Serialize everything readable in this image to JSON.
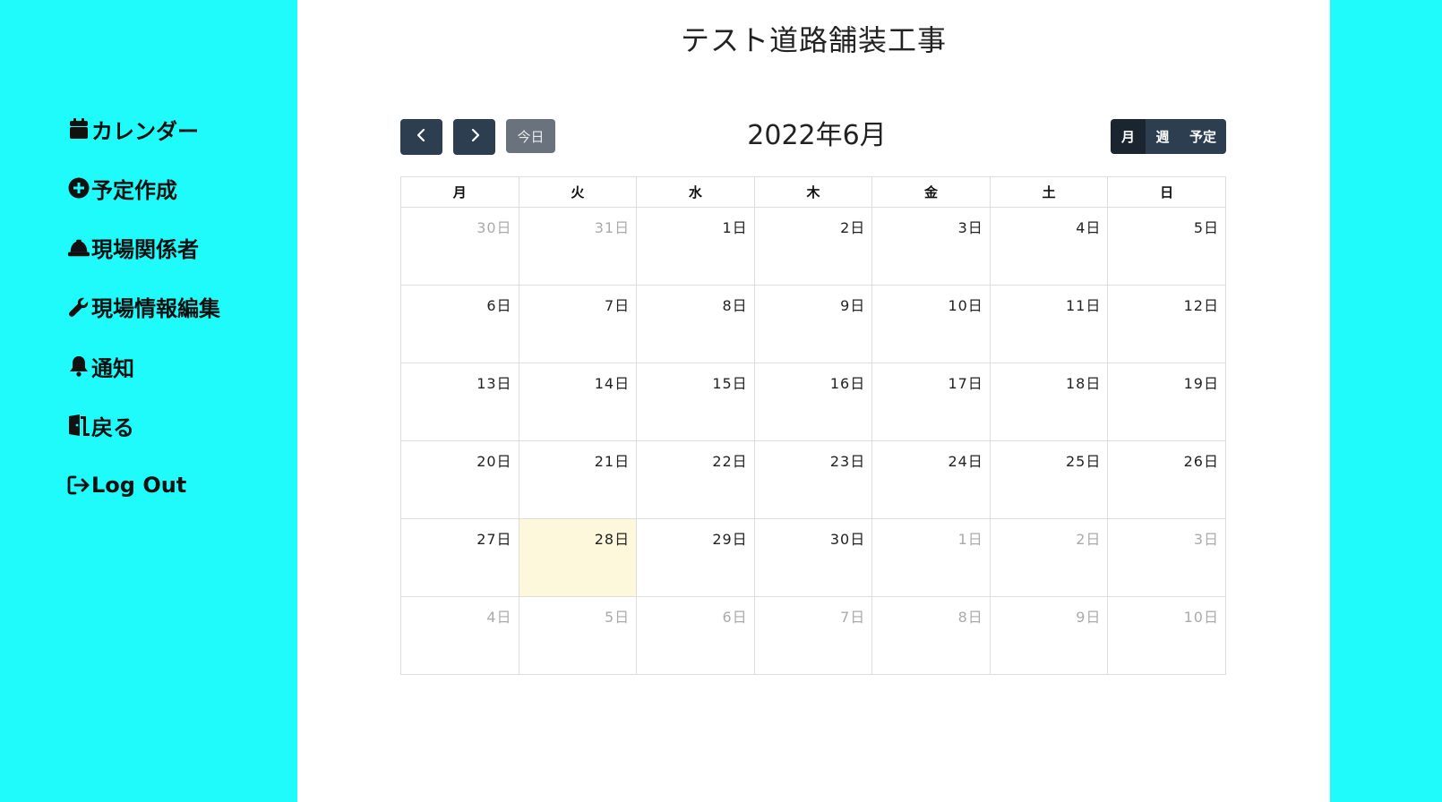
{
  "sidebar": {
    "items": [
      {
        "label": "カレンダー",
        "icon": "calendar-icon"
      },
      {
        "label": "予定作成",
        "icon": "plus-circle-icon"
      },
      {
        "label": "現場関係者",
        "icon": "hard-hat-icon"
      },
      {
        "label": "現場情報編集",
        "icon": "wrench-icon"
      },
      {
        "label": "通知",
        "icon": "bell-icon"
      },
      {
        "label": "戻る",
        "icon": "door-open-icon"
      },
      {
        "label": "Log Out",
        "icon": "sign-out-icon"
      }
    ]
  },
  "page": {
    "title": "テスト道路舗装工事"
  },
  "calendar": {
    "title": "2022年6月",
    "today_label": "今日",
    "prev_icon": "chevron-left-icon",
    "next_icon": "chevron-right-icon",
    "views": [
      "月",
      "週",
      "予定"
    ],
    "active_view": "月",
    "weekdays": [
      "月",
      "火",
      "水",
      "木",
      "金",
      "土",
      "日"
    ],
    "weeks": [
      [
        {
          "d": "30日",
          "other": true
        },
        {
          "d": "31日",
          "other": true
        },
        {
          "d": "1日"
        },
        {
          "d": "2日"
        },
        {
          "d": "3日"
        },
        {
          "d": "4日"
        },
        {
          "d": "5日"
        }
      ],
      [
        {
          "d": "6日"
        },
        {
          "d": "7日"
        },
        {
          "d": "8日"
        },
        {
          "d": "9日"
        },
        {
          "d": "10日"
        },
        {
          "d": "11日"
        },
        {
          "d": "12日"
        }
      ],
      [
        {
          "d": "13日"
        },
        {
          "d": "14日"
        },
        {
          "d": "15日"
        },
        {
          "d": "16日"
        },
        {
          "d": "17日"
        },
        {
          "d": "18日"
        },
        {
          "d": "19日"
        }
      ],
      [
        {
          "d": "20日"
        },
        {
          "d": "21日"
        },
        {
          "d": "22日"
        },
        {
          "d": "23日"
        },
        {
          "d": "24日"
        },
        {
          "d": "25日"
        },
        {
          "d": "26日"
        }
      ],
      [
        {
          "d": "27日"
        },
        {
          "d": "28日",
          "today": true
        },
        {
          "d": "29日"
        },
        {
          "d": "30日"
        },
        {
          "d": "1日",
          "other": true
        },
        {
          "d": "2日",
          "other": true
        },
        {
          "d": "3日",
          "other": true
        }
      ],
      [
        {
          "d": "4日",
          "other": true
        },
        {
          "d": "5日",
          "other": true
        },
        {
          "d": "6日",
          "other": true
        },
        {
          "d": "7日",
          "other": true
        },
        {
          "d": "8日",
          "other": true
        },
        {
          "d": "9日",
          "other": true
        },
        {
          "d": "10日",
          "other": true
        }
      ]
    ]
  },
  "colors": {
    "sidebar_bg": "#1ffbfb",
    "button_dark": "#2c3e50",
    "today_bg": "#fdf8dc"
  }
}
